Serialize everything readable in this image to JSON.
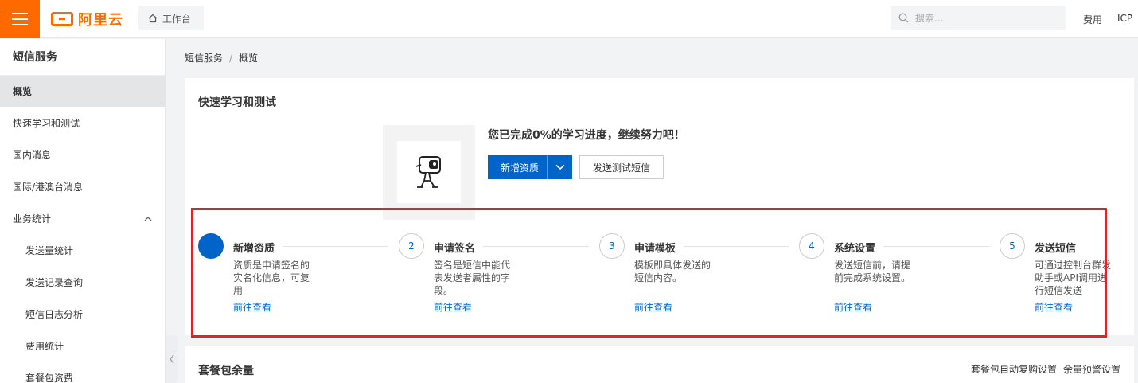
{
  "header": {
    "logo_text": "阿里云",
    "workbench_label": "工作台",
    "search_placeholder": "搜索...",
    "links": [
      "费用",
      "ICP"
    ]
  },
  "sidebar": {
    "title": "短信服务",
    "items": [
      {
        "label": "概览",
        "active": true
      },
      {
        "label": "快速学习和测试"
      },
      {
        "label": "国内消息"
      },
      {
        "label": "国际/港澳台消息"
      },
      {
        "label": "业务统计",
        "expanded": true
      },
      {
        "label": "发送量统计",
        "sub": true
      },
      {
        "label": "发送记录查询",
        "sub": true
      },
      {
        "label": "短信日志分析",
        "sub": true
      },
      {
        "label": "费用统计",
        "sub": true
      },
      {
        "label": "套餐包资费",
        "sub": true
      }
    ]
  },
  "breadcrumb": [
    "短信服务",
    "概览"
  ],
  "quick_learn": {
    "title": "快速学习和测试",
    "progress_text": "您已完成0%的学习进度，继续努力吧！",
    "primary_button": "新增资质",
    "secondary_button": "发送测试短信"
  },
  "steps": [
    {
      "number": "",
      "title": "新增资质",
      "desc": "资质是申请签名的实名化信息，可复用",
      "link": "前往查看",
      "done": true
    },
    {
      "number": "2",
      "title": "申请签名",
      "desc": "签名是短信中能代表发送者属性的字段。",
      "link": "前往查看"
    },
    {
      "number": "3",
      "title": "申请模板",
      "desc": "模板即具体发送的短信内容。",
      "link": "前往查看"
    },
    {
      "number": "4",
      "title": "系统设置",
      "desc": "发送短信前，请提前完成系统设置。",
      "link": "前往查看"
    },
    {
      "number": "5",
      "title": "发送短信",
      "desc": "可通过控制台群发助手或API调用进行短信发送",
      "link": "前往查看"
    }
  ],
  "package": {
    "title": "套餐包余量",
    "links": [
      "套餐包自动复购设置",
      "余量预警设置"
    ]
  },
  "colors": {
    "brand": "#ff6a00",
    "primary": "#0064c8",
    "highlight": "#d9262b"
  }
}
